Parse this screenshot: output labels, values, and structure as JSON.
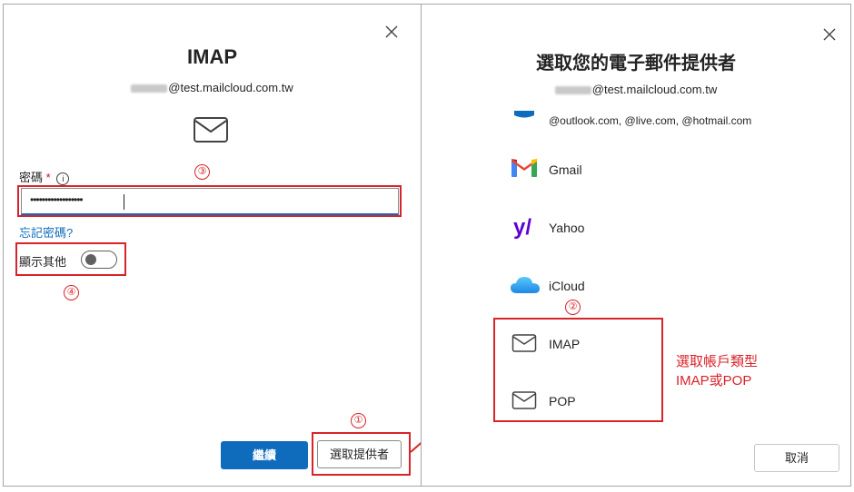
{
  "left": {
    "title": "IMAP",
    "email_domain": "@test.mailcloud.com.tw",
    "password_label": "密碼",
    "required_mark": "*",
    "info_icon": "i",
    "password_mask": "••••••••••••••••••",
    "forgot_link": "忘記密碼?",
    "toggle_label": "顯示其他",
    "toggle_on": false,
    "continue_button": "繼續",
    "choose_provider_button": "選取提供者",
    "icons": {
      "close": "close-icon",
      "mail": "envelope-icon",
      "info": "info-icon"
    }
  },
  "right": {
    "title": "選取您的電子郵件提供者",
    "email_domain": "@test.mailcloud.com.tw",
    "providers": [
      {
        "name": "@outlook.com, @live.com, @hotmail.com",
        "icon": "outlook-icon"
      },
      {
        "name": "Gmail",
        "icon": "gmail-icon"
      },
      {
        "name": "Yahoo",
        "icon": "yahoo-icon"
      },
      {
        "name": "iCloud",
        "icon": "icloud-icon"
      },
      {
        "name": "IMAP",
        "icon": "envelope-icon"
      },
      {
        "name": "POP",
        "icon": "envelope-icon"
      }
    ],
    "cancel_button": "取消"
  },
  "annotations": {
    "step1": "①",
    "step2": "②",
    "step3": "③",
    "step4": "④",
    "note_line1": "選取帳戶類型",
    "note_line2": "IMAP或POP"
  },
  "colors": {
    "accent": "#0f6cbd",
    "annotation": "#d8232a",
    "link": "#0f6cbd"
  }
}
